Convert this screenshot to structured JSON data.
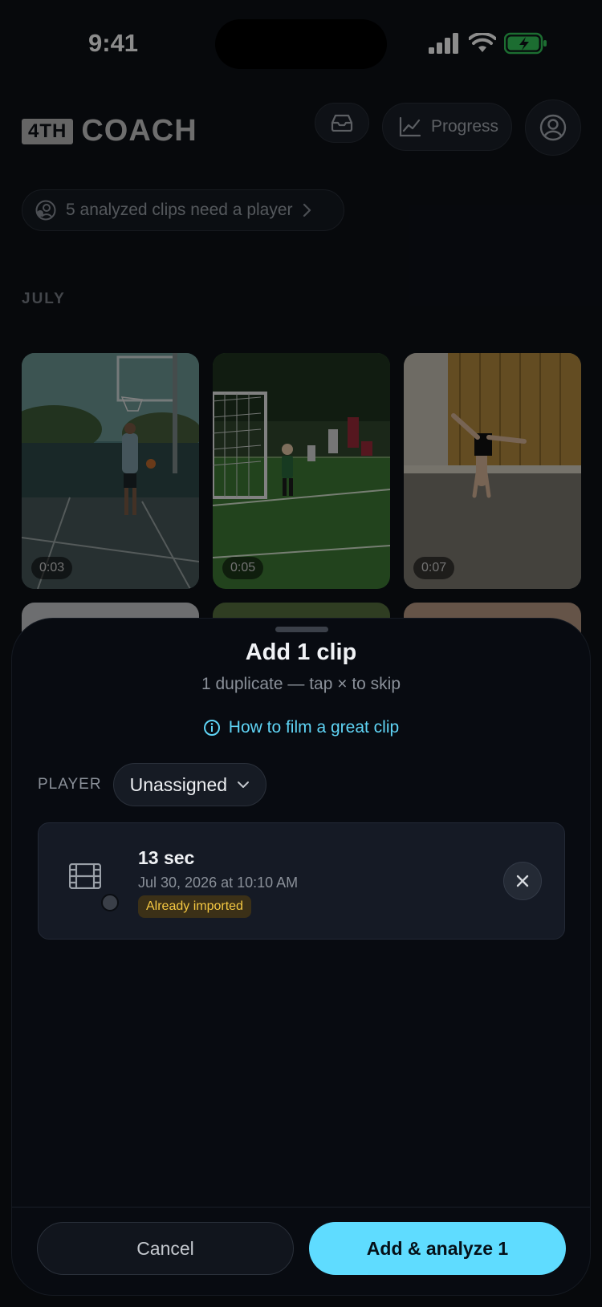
{
  "status_bar": {
    "time": "9:41"
  },
  "header": {
    "logo_badge": "4TH",
    "logo_word": "COACH",
    "progress_label": "Progress"
  },
  "notice": {
    "text": "5 analyzed clips need a player"
  },
  "section": {
    "label": "JULY"
  },
  "clips": [
    {
      "duration": "0:03"
    },
    {
      "duration": "0:05"
    },
    {
      "duration": "0:07"
    }
  ],
  "sheet": {
    "title": "Add 1 clip",
    "subtitle": "1 duplicate — tap × to skip",
    "help_link": "How to film a great clip",
    "player_label": "PLAYER",
    "player_value": "Unassigned",
    "clip": {
      "length": "13 sec",
      "date": "Jul 30, 2026 at 10:10 AM",
      "badge": "Already imported"
    },
    "cancel_label": "Cancel",
    "primary_label": "Add & analyze 1"
  },
  "colors": {
    "accent": "#5fdcff",
    "link": "#5fd4f5",
    "warning": "#f5c842",
    "battery": "#34c759"
  }
}
